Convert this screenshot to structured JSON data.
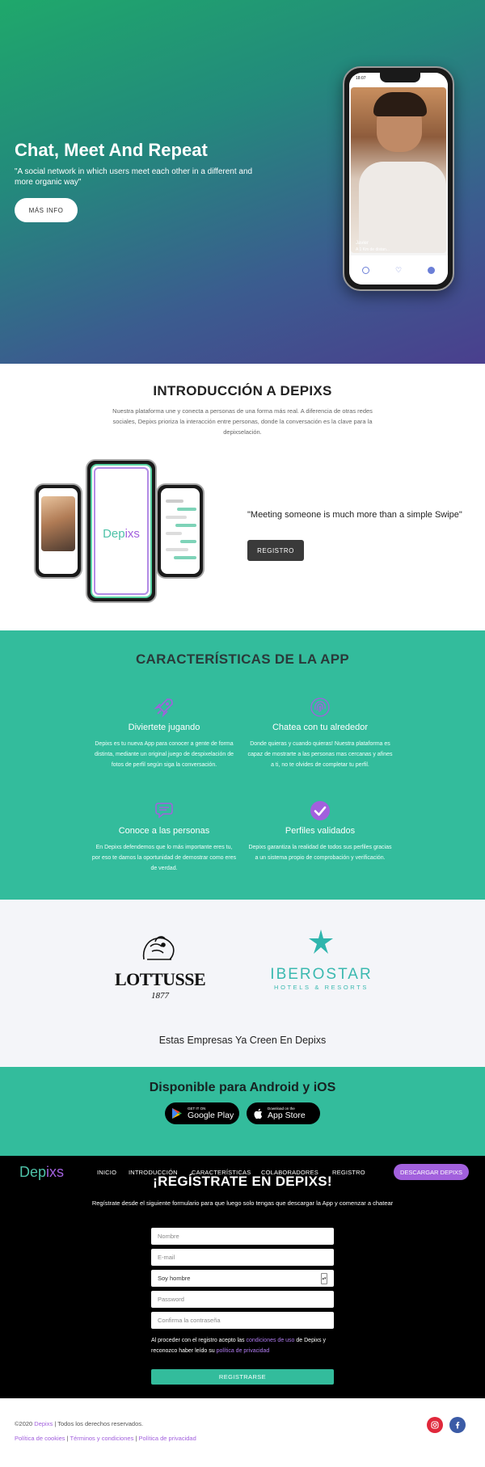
{
  "hero": {
    "title": "Chat, Meet And Repeat",
    "subtitle": "\"A social network in which users meet each other in a different and more organic way\"",
    "cta": "MÁS INFO",
    "phone": {
      "time": "18:07",
      "name": "Javier",
      "distance": "A 1 Km de distan..."
    }
  },
  "intro": {
    "title": "INTRODUCCIÓN A DEPIXS",
    "text": "Nuestra plataforma une y conecta a personas de una forma más real. A diferencia de otras redes sociales, Depixs prioriza la interacción entre personas, donde la conversación es la clave para la depixselación.",
    "logo_a": "Dep",
    "logo_b": "ixs",
    "quote": "\"Meeting someone is much more than a simple Swipe\"",
    "button": "REGISTRO"
  },
  "features": {
    "title": "CARACTERÍSTICAS DE LA APP",
    "items": [
      {
        "icon": "rocket-icon",
        "title": "Diviertete jugando",
        "desc": "Depixs es tu nueva App para conocer a gente de forma distinta, mediante un original juego de despixelación de fotos de perfil según siga la conversación."
      },
      {
        "icon": "fingerprint-icon",
        "title": "Chatea con tu alrededor",
        "desc": "Donde quieras y cuando quieras! Nuestra plataforma es capaz de mostrarte a las personas mas cercanas y afines a ti, no te olvides de completar tu perfil."
      },
      {
        "icon": "chat-bubbles-icon",
        "title": "Conoce a las personas",
        "desc": "En Depixs defendemos que lo más importante eres tu, por eso te damos la oportunidad de demostrar como eres de verdad."
      },
      {
        "icon": "verified-check-icon",
        "title": "Perfiles validados",
        "desc": "Depixs garantiza la realidad de todos sus perfiles gracias a un sistema propio de comprobación y verificación."
      }
    ],
    "accent": "#a260dd"
  },
  "partners": {
    "lottusse": {
      "name": "LOTTUSSE",
      "year": "1877"
    },
    "iberostar": {
      "name": "IBEROSTAR",
      "sub": "HOTELS & RESORTS",
      "color": "#3bb9b0"
    },
    "caption": "Estas Empresas Ya Creen En Depixs"
  },
  "available": {
    "title": "Disponible para Android y iOS",
    "google": {
      "small": "GET IT ON",
      "big": "Google Play"
    },
    "apple": {
      "small": "Download on the",
      "big": "App Store"
    }
  },
  "register": {
    "brand_a": "Dep",
    "brand_b": "ixs",
    "nav": [
      "INICIO",
      "INTRODUCCIÓN",
      "CARACTERÍSTICAS",
      "COLABORADORES",
      "REGISTRO"
    ],
    "download": "DESCARGAR DEPIXS",
    "title": "¡REGÍSTRATE EN DEPIXS!",
    "subtitle": "Regístrate desde el siguiente formulario para que luego solo tengas que descargar la App y comenzar a chatear",
    "name_placeholder": "Nombre",
    "email_placeholder": "E-mail",
    "gender_value": "Soy hombre",
    "password_placeholder": "Password",
    "confirm_placeholder": "Confirma la contraseña",
    "legal_1": "Al proceder con el registro acepto las ",
    "legal_link_1": "condiciones de uso",
    "legal_2": " de Depixs y reconozco haber leído su ",
    "legal_link_2": "política de privacidad",
    "submit": "REGISTRARSE"
  },
  "footer": {
    "copy_a": "©2020 ",
    "copy_b": "Depixs",
    "copy_c": " | Todos los derechos reservados.",
    "cookies": "Política de cookies",
    "terms": "Términos y condiciones",
    "privacy": "Política de privacidad",
    "sep": " | ",
    "instagram_icon": "instagram-icon",
    "facebook_icon": "facebook-icon",
    "brand_green": "#33bc9c",
    "brand_purple": "#a260dd"
  }
}
